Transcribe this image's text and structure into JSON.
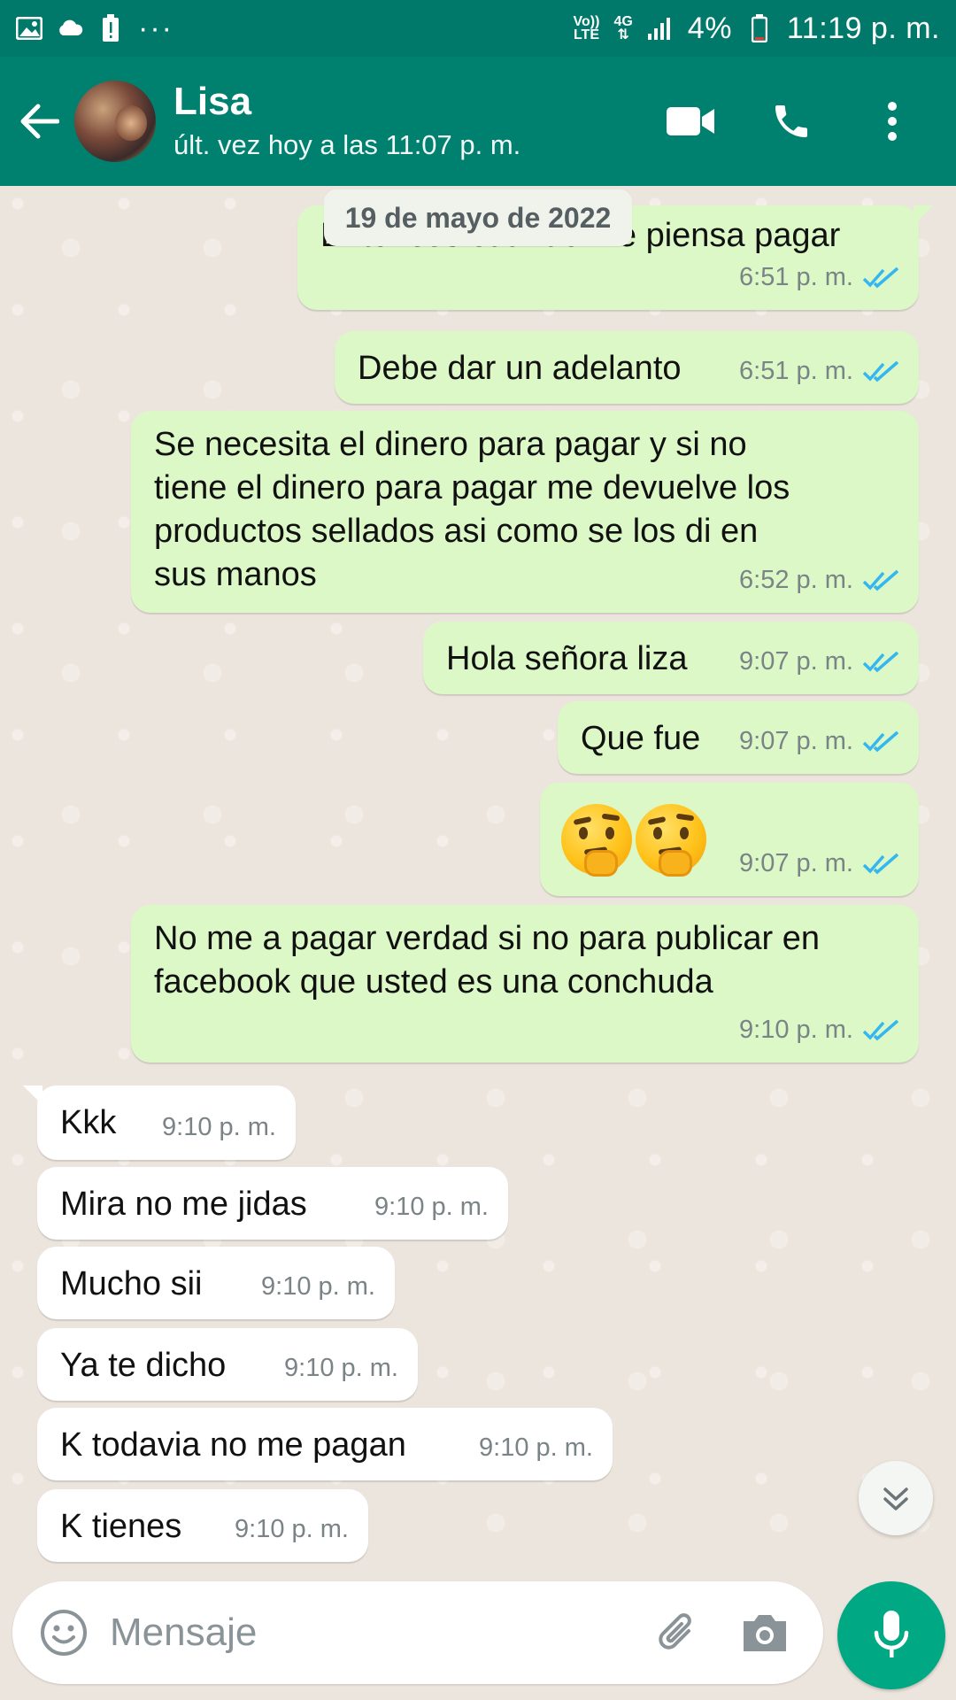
{
  "status_bar": {
    "network_label_top": "Vo))",
    "network_label_bottom": "LTE",
    "network_type": "4G",
    "battery": "4%",
    "time": "11:19 p. m.",
    "dots": "···"
  },
  "header": {
    "contact_name": "Lisa",
    "last_seen": "últ. vez hoy a las 11:07 p. m."
  },
  "date_chip": "19 de mayo de 2022",
  "messages": [
    {
      "dir": "out",
      "text": "Entonces cuando me piensa pagar",
      "time": "6:51 p. m."
    },
    {
      "dir": "out",
      "text": "Debe dar un adelanto",
      "time": "6:51 p. m."
    },
    {
      "dir": "out",
      "lines": [
        "Se necesita el dinero para pagar y si no",
        "tiene el dinero para pagar me devuelve los",
        "productos sellados asi como se los di en",
        "sus manos"
      ],
      "time": "6:52 p. m."
    },
    {
      "dir": "out",
      "text": "Hola señora liza",
      "time": "9:07 p. m."
    },
    {
      "dir": "out",
      "text": "Que fue",
      "time": "9:07 p. m."
    },
    {
      "dir": "out",
      "emoji": "thinking-face x2",
      "time": "9:07 p. m."
    },
    {
      "dir": "out",
      "lines": [
        "No me a pagar verdad si no para publicar en",
        "facebook que usted es una  conchuda"
      ],
      "time": "9:10 p. m."
    },
    {
      "dir": "in",
      "text": "Kkk",
      "time": "9:10 p. m."
    },
    {
      "dir": "in",
      "text": "Mira no me jidas",
      "time": "9:10 p. m."
    },
    {
      "dir": "in",
      "text": "Mucho sii",
      "time": "9:10 p. m."
    },
    {
      "dir": "in",
      "text": "Ya te dicho",
      "time": "9:10 p. m."
    },
    {
      "dir": "in",
      "text": "K todavia no me pagan",
      "time": "9:10 p. m."
    },
    {
      "dir": "in",
      "text": "K tienes",
      "time": "9:10 p. m."
    }
  ],
  "input": {
    "placeholder": "Mensaje",
    "value": ""
  },
  "colors": {
    "header": "#00806f",
    "outgoing_bubble": "#dcf8c6",
    "incoming_bubble": "#ffffff",
    "read_check": "#34b7f1",
    "mic_button": "#00a884"
  },
  "icons": {
    "back": "arrow-left-icon",
    "video": "video-camera-icon",
    "call": "phone-icon",
    "menu": "more-vert-icon",
    "emoji": "smiley-icon",
    "attach": "paperclip-icon",
    "camera": "camera-icon",
    "mic": "microphone-icon",
    "scroll_down": "chevron-double-down-icon"
  }
}
